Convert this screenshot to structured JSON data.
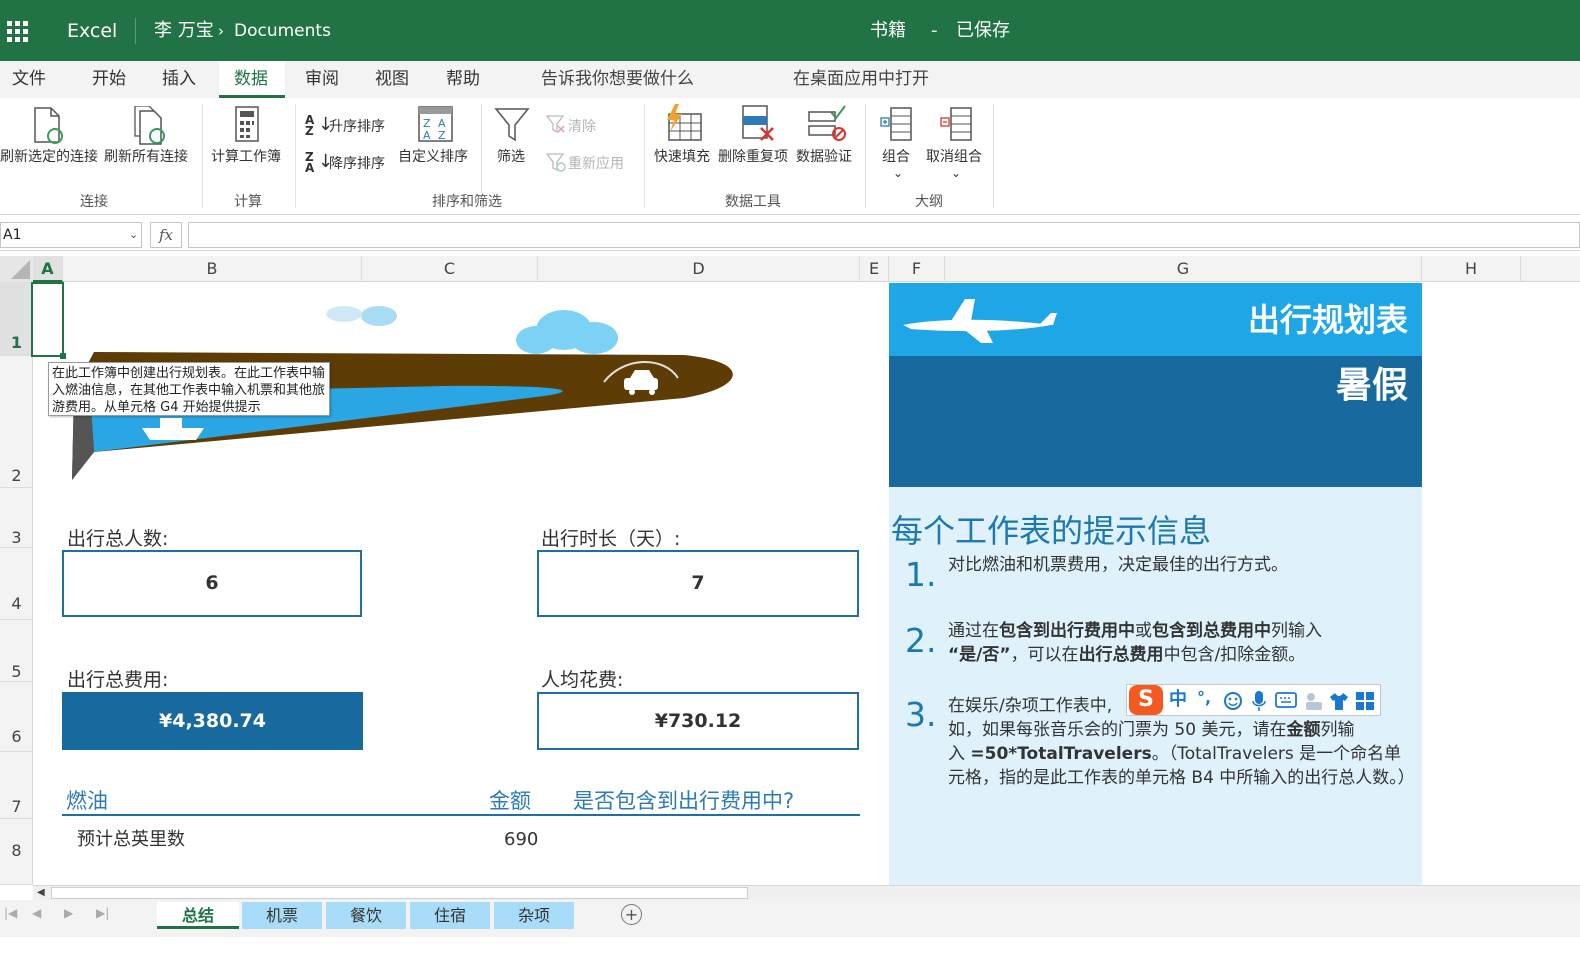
{
  "title_bar": {
    "app_name": "Excel",
    "user": "李 万宝",
    "breadcrumb_sep": "›",
    "folder": "Documents",
    "file_name": "书籍",
    "dash": "-",
    "save_status": "已保存"
  },
  "menu": {
    "items": [
      "文件",
      "开始",
      "插入",
      "数据",
      "审阅",
      "视图",
      "帮助"
    ],
    "active": "数据",
    "tell_me": "告诉我你想要做什么",
    "open_desktop": "在桌面应用中打开"
  },
  "ribbon": {
    "refresh_selected": "刷新选定的连接",
    "refresh_all": "刷新所有连接",
    "group_connections": "连接",
    "calc_workbook": "计算工作簿",
    "group_calc": "计算",
    "sort_asc": "升序排序",
    "sort_desc": "降序排序",
    "custom_sort": "自定义排序",
    "filter": "筛选",
    "clear": "清除",
    "reapply": "重新应用",
    "group_sort_filter": "排序和筛选",
    "flash_fill": "快速填充",
    "remove_duplicates": "删除重复项",
    "data_validation": "数据验证",
    "group_data_tools": "数据工具",
    "group_btn": "组合",
    "ungroup_btn": "取消组合",
    "group_outline": "大纲",
    "chevron": "⌄"
  },
  "formula_bar": {
    "name_box": "A1",
    "fx": "fx",
    "formula": ""
  },
  "grid": {
    "columns": [
      "A",
      "B",
      "C",
      "D",
      "E",
      "F",
      "G",
      "H"
    ],
    "rows": [
      "1",
      "2",
      "3",
      "4",
      "5",
      "6",
      "7",
      "8"
    ],
    "selected_col": "A",
    "selected_row": "1"
  },
  "sheet": {
    "tooltip": "在此工作簿中创建出行规划表。在此工作表中输入燃油信息，在其他工作表中输入机票和其他旅游费用。从单元格 G4 开始提供提示",
    "total_travelers_label": "出行总人数:",
    "total_travelers_value": "6",
    "trip_length_label": "出行时长（天）:",
    "trip_length_value": "7",
    "total_cost_label": "出行总费用:",
    "total_cost_value": "¥4,380.74",
    "per_person_label": "人均花费:",
    "per_person_value": "¥730.12",
    "fuel_header": "燃油",
    "amount_header": "金额",
    "include_header": "是否包含到出行费用中?",
    "miles_label": "预计总英里数",
    "miles_value": "690"
  },
  "panel": {
    "title": "出行规划表",
    "subtitle": "暑假",
    "tips_heading": "每个工作表的提示信息",
    "tip1_num": "1.",
    "tip1": "对比燃油和机票费用，决定最佳的出行方式。",
    "tip2_num": "2.",
    "tip2_a": "通过在",
    "tip2_b": "包含到出行费用中",
    "tip2_c": "或",
    "tip2_d": "包含到总费用中",
    "tip2_e": "列输入",
    "tip2_f": "“是/否”",
    "tip2_g": "，可以在",
    "tip2_h": "出行总费用",
    "tip2_i": "中包含/扣除金额。",
    "tip3_num": "3.",
    "tip3_a": "在娱乐/杂项工作表中,",
    "tip3_b": "例",
    "tip3_c": "如，如果每张音乐会的门票为 50 美元，请在",
    "tip3_d": "金额",
    "tip3_e": "列输",
    "tip3_f": "入 ",
    "tip3_g": "=50*TotalTravelers",
    "tip3_h": "。（TotalTravelers 是一个命名单元格，指的是此工作表的单元格 B4 中所输入的出行总人数。）"
  },
  "ime": {
    "logo": "S",
    "lang": "中",
    "punct": "°,"
  },
  "sheet_tabs": {
    "tabs": [
      "总结",
      "机票",
      "餐饮",
      "住宿",
      "杂项"
    ],
    "active": "总结",
    "add": "+"
  },
  "colors": {
    "excel_green": "#217346",
    "panel_light": "#1ea6e6",
    "panel_dark": "#17699e",
    "tab_blue": "#a9dcf9",
    "accent_blue": "#2b7bb8"
  }
}
